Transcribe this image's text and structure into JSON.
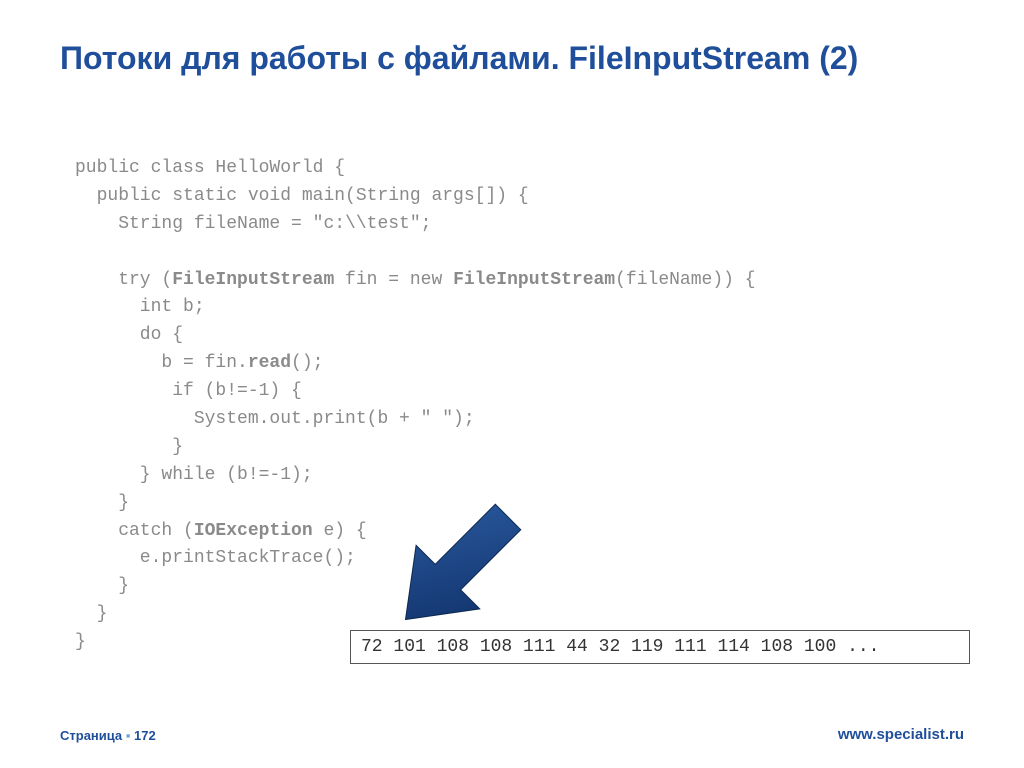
{
  "title": "Потоки для работы с файлами. FileInputStream (2)",
  "code": {
    "l1": "public class HelloWorld {",
    "l2a": "  public static void main(String args[]) {",
    "l3": "    String fileName = \"c:\\\\test\";",
    "l4": "",
    "l5a": "    try (",
    "l5b": "FileInputStream",
    "l5c": " fin = new ",
    "l5d": "FileInputStream",
    "l5e": "(fileName)) {",
    "l6": "      int b;",
    "l7": "      do {",
    "l8a": "        b = fin.",
    "l8b": "read",
    "l8c": "();",
    "l9": "         if (b!=-1) {",
    "l10": "           System.out.print(b + \" \");",
    "l11": "         }",
    "l12": "      } while (b!=-1);",
    "l13": "    }",
    "l14a": "    catch (",
    "l14b": "IOException",
    "l14c": " e) {",
    "l15": "      e.printStackTrace();",
    "l16": "    }",
    "l17": "  }",
    "l18": "}"
  },
  "output": "72 101 108 108 111 44 32 119 111 114 108 100 ...",
  "footer": {
    "page_label": "Страница",
    "page_num": "172",
    "url": "www.specialist.ru"
  }
}
